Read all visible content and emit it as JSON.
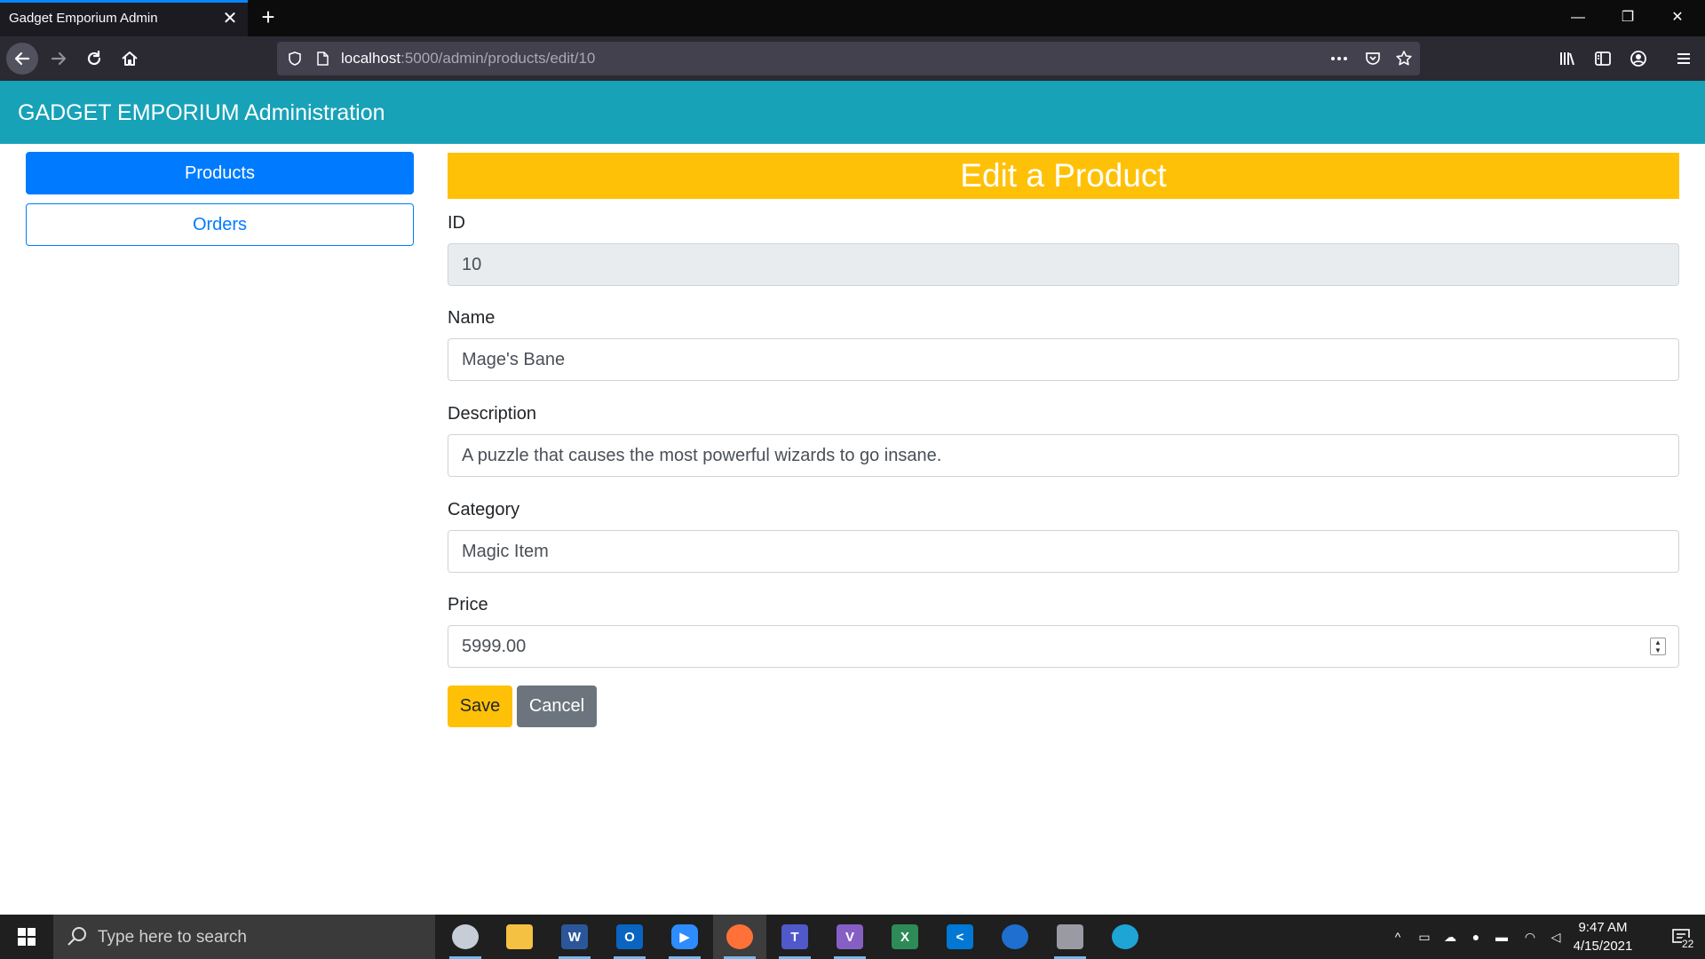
{
  "browser": {
    "tab_title": "Gadget Emporium Admin",
    "tab_close": "✕",
    "new_tab": "+",
    "url_host": "localhost",
    "url_path": ":5000/admin/products/edit/10",
    "window_controls": {
      "minimize": "—",
      "restore": "❐",
      "close": "✕"
    }
  },
  "app": {
    "brand": "GADGET EMPORIUM Administration",
    "sidebar": [
      {
        "label": "Products",
        "active": true
      },
      {
        "label": "Orders",
        "active": false
      }
    ],
    "form": {
      "title": "Edit a Product",
      "fields": {
        "id": {
          "label": "ID",
          "value": "10"
        },
        "name": {
          "label": "Name",
          "value": "Mage's Bane"
        },
        "description": {
          "label": "Description",
          "value": "A puzzle that causes the most powerful wizards to go insane."
        },
        "category": {
          "label": "Category",
          "value": "Magic Item"
        },
        "price": {
          "label": "Price",
          "value": "5999.00"
        }
      },
      "save_label": "Save",
      "cancel_label": "Cancel"
    },
    "colors": {
      "header": "#17a2b8",
      "primary": "#007bff",
      "warning": "#ffc107",
      "secondary": "#6c757d"
    }
  },
  "taskbar": {
    "search_placeholder": "Type here to search",
    "time": "9:47 AM",
    "date": "4/15/2021",
    "notification_count": "22",
    "apps": [
      "snip-sketch-icon",
      "file-explorer-icon",
      "word-icon",
      "outlook-icon",
      "zoom-icon",
      "firefox-icon",
      "teams-icon",
      "visual-studio-icon",
      "excel-like-icon",
      "vscode-icon",
      "azure-data-studio-icon",
      "screen-recorder-icon",
      "edge-icon"
    ]
  }
}
